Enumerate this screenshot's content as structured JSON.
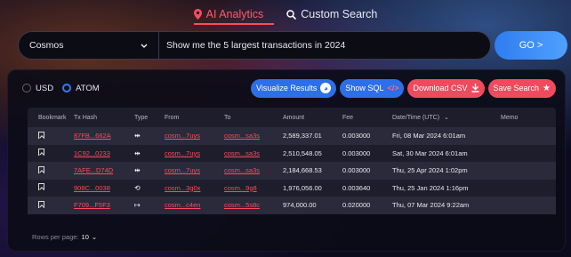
{
  "nav": {
    "tabs": [
      {
        "label": "AI Analytics",
        "icon": "location-pin-icon",
        "active": true
      },
      {
        "label": "Custom Search",
        "icon": "search-icon",
        "active": false
      }
    ]
  },
  "search": {
    "chain": "Cosmos",
    "query": "Show me the 5 largest transactions in 2024",
    "go_label": "GO >"
  },
  "controls": {
    "currency_options": [
      "USD",
      "ATOM"
    ],
    "selected_currency": "ATOM",
    "visualize_label": "Visualize Results",
    "show_sql_label": "Show SQL",
    "download_label": "Download CSV",
    "save_label": "Save Search"
  },
  "table": {
    "headers": [
      "Bookmark",
      "Tx Hash",
      "Type",
      "From",
      "To",
      "Amount",
      "Fee",
      "Date/Time (UTC)",
      "Memo"
    ],
    "rows": [
      {
        "hash": "87FB...662A",
        "type_icon": "transfer-icon",
        "from": "cosm...7uys",
        "to": "cosm...sa3s",
        "amount": "2,589,337.01",
        "fee": "0.003000",
        "date": "Fri, 08 Mar 2024 6:01am",
        "memo": ""
      },
      {
        "hash": "1C92...0233",
        "type_icon": "transfer-icon",
        "from": "cosm...7uys",
        "to": "cosm...sa3s",
        "amount": "2,510,548.05",
        "fee": "0.003000",
        "date": "Sat, 30 Mar 2024 6:01am",
        "memo": ""
      },
      {
        "hash": "7AFE...D74D",
        "type_icon": "transfer-icon",
        "from": "cosm...7uys",
        "to": "cosm...sa3s",
        "amount": "2,184,668.53",
        "fee": "0.003000",
        "date": "Thu, 25 Apr 2024 1:02pm",
        "memo": ""
      },
      {
        "hash": "908C...0038",
        "type_icon": "redelegate-icon",
        "from": "cosm...3g0x",
        "to": "cosm...9g8",
        "amount": "1,976,056.00",
        "fee": "0.003640",
        "date": "Thu, 25 Jan 2024 1:16pm",
        "memo": ""
      },
      {
        "hash": "F709...F5F3",
        "type_icon": "send-icon",
        "from": "cosm...c4en",
        "to": "cosm...5s8c",
        "amount": "974,000.00",
        "fee": "0.020000",
        "date": "Thu, 07 Mar 2024 9:22am",
        "memo": ""
      }
    ]
  },
  "pager": {
    "label": "Rows per page:",
    "value": "10"
  },
  "colors": {
    "accent_red": "#ff4a5e",
    "accent_blue": "#2d6fe8"
  }
}
